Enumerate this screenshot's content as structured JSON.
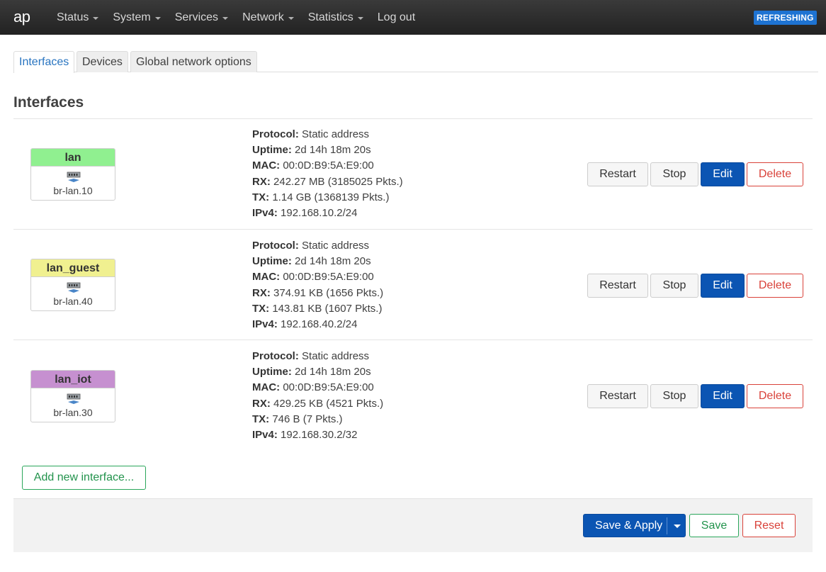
{
  "brand": "ap",
  "status_badge": "REFRESHING",
  "menu": [
    "Status",
    "System",
    "Services",
    "Network",
    "Statistics",
    "Log out"
  ],
  "tabs": [
    "Interfaces",
    "Devices",
    "Global network options"
  ],
  "section_title": "Interfaces",
  "labels": {
    "protocol": "Protocol:",
    "uptime": "Uptime:",
    "mac": "MAC:",
    "rx": "RX:",
    "tx": "TX:",
    "ipv4": "IPv4:"
  },
  "buttons": {
    "restart": "Restart",
    "stop": "Stop",
    "edit": "Edit",
    "delete": "Delete",
    "add": "Add new interface...",
    "save_apply": "Save & Apply",
    "save": "Save",
    "reset": "Reset"
  },
  "interfaces": [
    {
      "name": "lan",
      "color": "#90f090",
      "device": "br-lan.10",
      "protocol": "Static address",
      "uptime": "2d 14h 18m 20s",
      "mac": "00:0D:B9:5A:E9:00",
      "rx": "242.27 MB (3185025 Pkts.)",
      "tx": "1.14 GB (1368139 Pkts.)",
      "ipv4": "192.168.10.2/24"
    },
    {
      "name": "lan_guest",
      "color": "#f0f090",
      "device": "br-lan.40",
      "protocol": "Static address",
      "uptime": "2d 14h 18m 20s",
      "mac": "00:0D:B9:5A:E9:00",
      "rx": "374.91 KB (1656 Pkts.)",
      "tx": "143.81 KB (1607 Pkts.)",
      "ipv4": "192.168.40.2/24"
    },
    {
      "name": "lan_iot",
      "color": "#c690d0",
      "device": "br-lan.30",
      "protocol": "Static address",
      "uptime": "2d 14h 18m 20s",
      "mac": "00:0D:B9:5A:E9:00",
      "rx": "429.25 KB (4521 Pkts.)",
      "tx": "746 B (7 Pkts.)",
      "ipv4": "192.168.30.2/32"
    }
  ],
  "icons": {
    "menu_caret": "caret-down-icon",
    "interface": "network-switch-icon",
    "save_apply_dropdown": "caret-down-icon"
  }
}
